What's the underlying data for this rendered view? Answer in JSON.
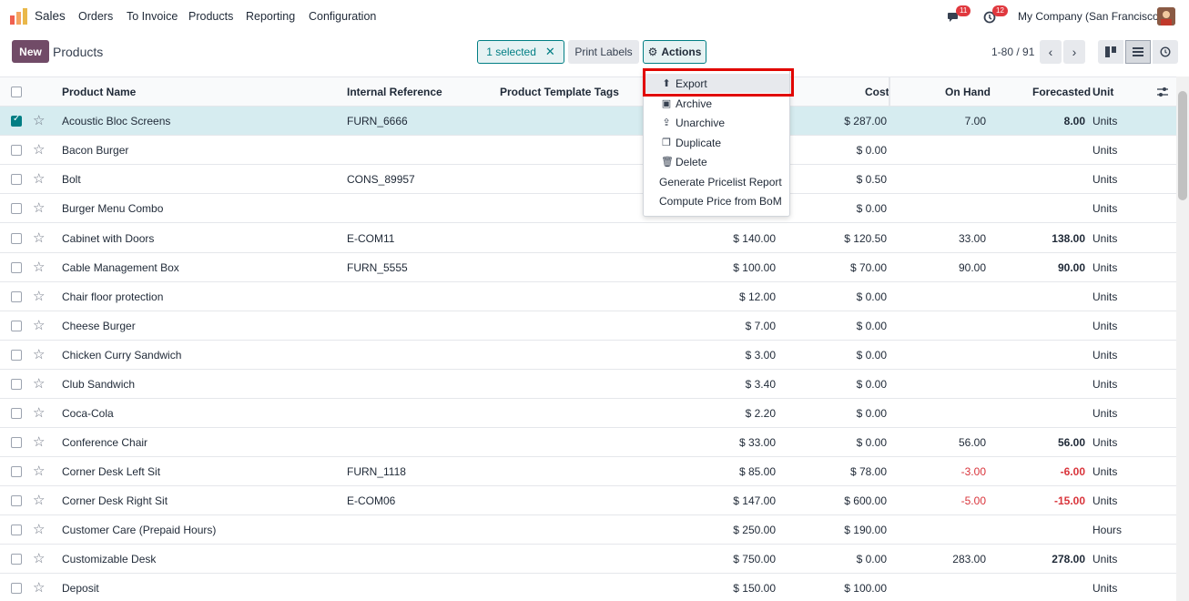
{
  "nav": {
    "app_name": "Sales",
    "menus": [
      "Orders",
      "To Invoice",
      "Products",
      "Reporting",
      "Configuration"
    ],
    "messages_count": "11",
    "activities_count": "12",
    "company": "My Company (San Francisco)"
  },
  "control": {
    "new_label": "New",
    "breadcrumb": "Products",
    "selected_label": "1 selected",
    "print_labels": "Print Labels",
    "actions_label": "Actions",
    "pager": "1-80 / 91"
  },
  "dropdown": {
    "items": [
      {
        "label": "Export",
        "icon": "upload-icon"
      },
      {
        "label": "Archive",
        "icon": "archive-icon"
      },
      {
        "label": "Unarchive",
        "icon": "unarchive-icon"
      },
      {
        "label": "Duplicate",
        "icon": "copy-icon"
      },
      {
        "label": "Delete",
        "icon": "trash-icon"
      },
      {
        "label": "Generate Pricelist Report",
        "icon": ""
      },
      {
        "label": "Compute Price from BoM",
        "icon": ""
      }
    ]
  },
  "table": {
    "headers": {
      "name": "Product Name",
      "ref": "Internal Reference",
      "tags": "Product Template Tags",
      "cost": "Cost",
      "onhand": "On Hand",
      "forecast": "Forecasted",
      "unit": "Unit"
    },
    "rows": [
      {
        "name": "Acoustic Bloc Screens",
        "ref": "FURN_6666",
        "price": "",
        "cost": "$ 287.00",
        "onhand": "7.00",
        "forecast": "8.00",
        "unit": "Units",
        "selected": true
      },
      {
        "name": "Bacon Burger",
        "ref": "",
        "price": "",
        "cost": "$ 0.00",
        "onhand": "",
        "forecast": "",
        "unit": "Units"
      },
      {
        "name": "Bolt",
        "ref": "CONS_89957",
        "price": "",
        "cost": "$ 0.50",
        "onhand": "",
        "forecast": "",
        "unit": "Units"
      },
      {
        "name": "Burger Menu Combo",
        "ref": "",
        "price": "",
        "cost": "$ 0.00",
        "onhand": "",
        "forecast": "",
        "unit": "Units"
      },
      {
        "name": "Cabinet with Doors",
        "ref": "E-COM11",
        "price": "$ 140.00",
        "cost": "$ 120.50",
        "onhand": "33.00",
        "forecast": "138.00",
        "unit": "Units"
      },
      {
        "name": "Cable Management Box",
        "ref": "FURN_5555",
        "price": "$ 100.00",
        "cost": "$ 70.00",
        "onhand": "90.00",
        "forecast": "90.00",
        "unit": "Units"
      },
      {
        "name": "Chair floor protection",
        "ref": "",
        "price": "$ 12.00",
        "cost": "$ 0.00",
        "onhand": "",
        "forecast": "",
        "unit": "Units"
      },
      {
        "name": "Cheese Burger",
        "ref": "",
        "price": "$ 7.00",
        "cost": "$ 0.00",
        "onhand": "",
        "forecast": "",
        "unit": "Units"
      },
      {
        "name": "Chicken Curry Sandwich",
        "ref": "",
        "price": "$ 3.00",
        "cost": "$ 0.00",
        "onhand": "",
        "forecast": "",
        "unit": "Units"
      },
      {
        "name": "Club Sandwich",
        "ref": "",
        "price": "$ 3.40",
        "cost": "$ 0.00",
        "onhand": "",
        "forecast": "",
        "unit": "Units"
      },
      {
        "name": "Coca-Cola",
        "ref": "",
        "price": "$ 2.20",
        "cost": "$ 0.00",
        "onhand": "",
        "forecast": "",
        "unit": "Units"
      },
      {
        "name": "Conference Chair",
        "ref": "",
        "price": "$ 33.00",
        "cost": "$ 0.00",
        "onhand": "56.00",
        "forecast": "56.00",
        "unit": "Units"
      },
      {
        "name": "Corner Desk Left Sit",
        "ref": "FURN_1118",
        "price": "$ 85.00",
        "cost": "$ 78.00",
        "onhand": "-3.00",
        "forecast": "-6.00",
        "unit": "Units"
      },
      {
        "name": "Corner Desk Right Sit",
        "ref": "E-COM06",
        "price": "$ 147.00",
        "cost": "$ 600.00",
        "onhand": "-5.00",
        "forecast": "-15.00",
        "unit": "Units"
      },
      {
        "name": "Customer Care (Prepaid Hours)",
        "ref": "",
        "price": "$ 250.00",
        "cost": "$ 190.00",
        "onhand": "",
        "forecast": "",
        "unit": "Hours"
      },
      {
        "name": "Customizable Desk",
        "ref": "",
        "price": "$ 750.00",
        "cost": "$ 0.00",
        "onhand": "283.00",
        "forecast": "278.00",
        "unit": "Units"
      },
      {
        "name": "Deposit",
        "ref": "",
        "price": "$ 150.00",
        "cost": "$ 100.00",
        "onhand": "",
        "forecast": "",
        "unit": "Units"
      }
    ]
  }
}
